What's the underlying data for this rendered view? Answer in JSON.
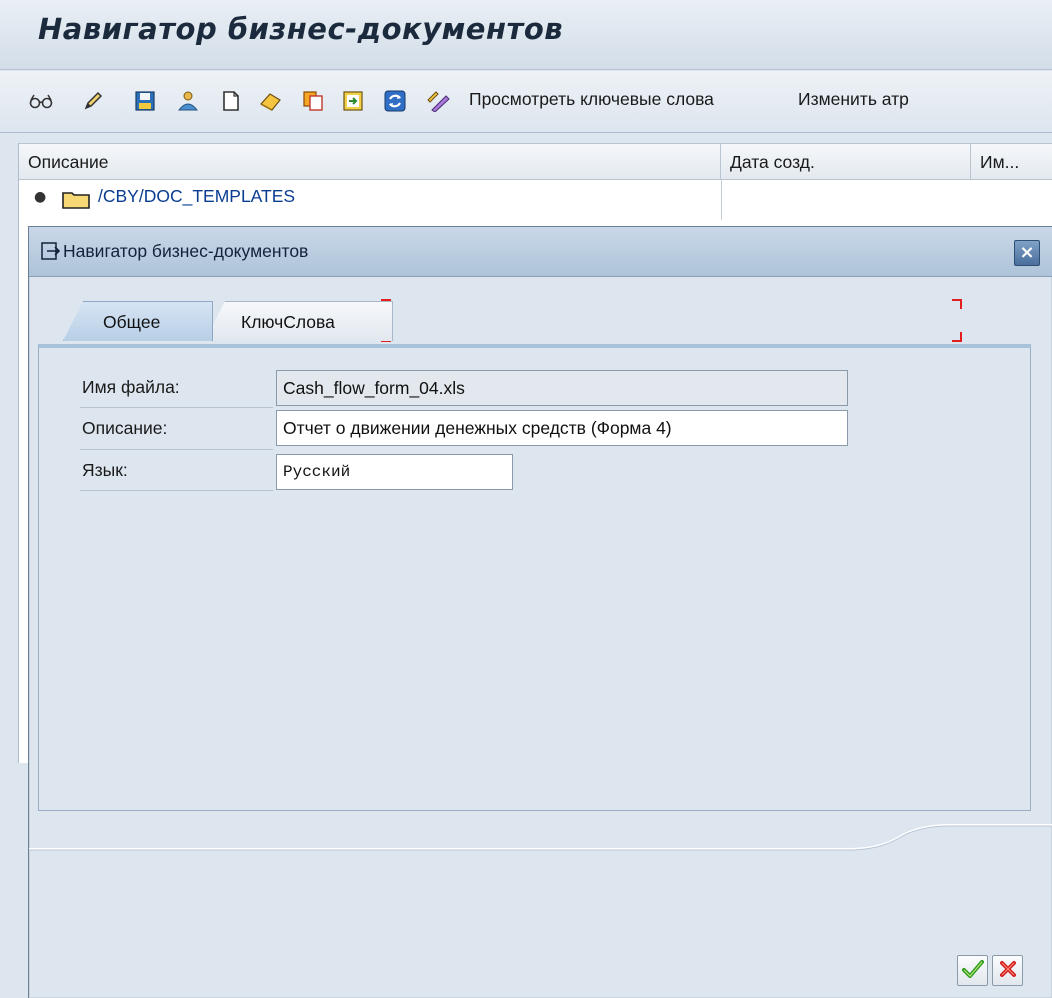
{
  "window": {
    "title": "Навигатор бизнес-документов"
  },
  "toolbar": {
    "icons": [
      "glasses-icon",
      "pencil-icon",
      "save-icon",
      "users-icon",
      "new-document-icon",
      "eraser-icon",
      "copy-icon",
      "export-icon",
      "refresh-icon",
      "edit-attributes-icon"
    ],
    "view_keywords_label": "Просмотреть ключевые слова",
    "change_attributes_label": "Изменить атр"
  },
  "tree": {
    "columns": [
      "Описание",
      "Дата созд.",
      "Им..."
    ],
    "rows": [
      {
        "label": "/CBY/DOC_TEMPLATES"
      }
    ]
  },
  "dialog": {
    "title": "Навигатор бизнес-документов",
    "close_label": "×",
    "tabs": [
      {
        "label": "Общее",
        "active": true
      },
      {
        "label": "КлючСлова",
        "active": false
      }
    ],
    "fields": {
      "filename_label": "Имя файла:",
      "filename_value": "Cash_flow_form_04.xls",
      "description_label": "Описание:",
      "description_value": "Отчет о движении денежных средств (Форма 4)",
      "language_label": "Язык:",
      "language_value": "Русский"
    },
    "buttons": {
      "confirm_icon": "checkmark-icon",
      "cancel_icon": "cancel-x-icon"
    }
  },
  "colors": {
    "accent_blue": "#aec3d9",
    "link_blue": "#0a3d91",
    "confirm_green": "#2e9a1b",
    "cancel_red": "#d42020",
    "focus_marker_red": "#e21f1f"
  }
}
